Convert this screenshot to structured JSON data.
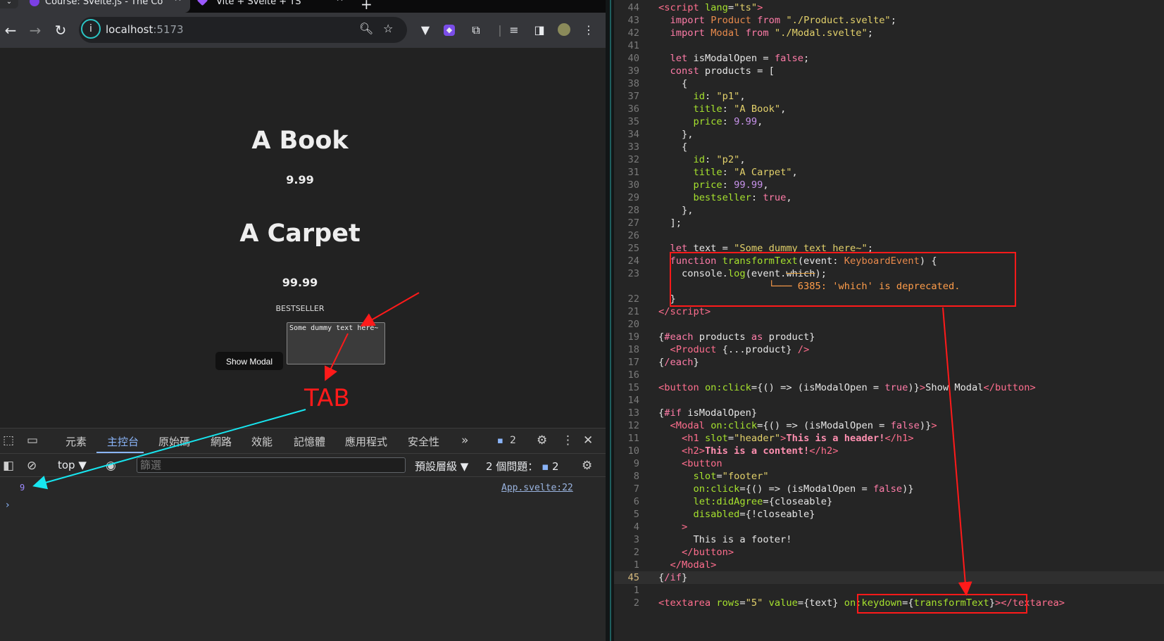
{
  "browser": {
    "tabs": [
      {
        "title": "Course: Svelte.js - The Co",
        "active": true
      },
      {
        "title": "Vite + Svelte + TS",
        "active": false
      }
    ],
    "address": {
      "host": "localhost",
      "port": ":5173"
    },
    "page": {
      "products": [
        {
          "title": "A Book",
          "price": "9.99"
        },
        {
          "title": "A Carpet",
          "price": "99.99",
          "badge": "BESTSELLER"
        }
      ],
      "show_modal_label": "Show Modal",
      "textarea_value": "Some dummy text here~"
    },
    "annotation": {
      "tab_label": "TAB",
      "color": "#ff1a1a",
      "cyan": "#17e6f0"
    }
  },
  "devtools": {
    "tabs": [
      "元素",
      "主控台",
      "原始碼",
      "網路",
      "效能",
      "記憶體",
      "應用程式",
      "安全性"
    ],
    "active_tab": "主控台",
    "issues_badge": "2",
    "context": "top",
    "filter_placeholder": "篩選",
    "levels": "預設層級",
    "issues_label": "2 個問題：",
    "issues_count": "2",
    "console": {
      "value": "9",
      "source": "App.svelte:22",
      "prompt": "›"
    }
  },
  "editor": {
    "current_line": "45",
    "warning": "6385: 'which' is deprecated."
  }
}
